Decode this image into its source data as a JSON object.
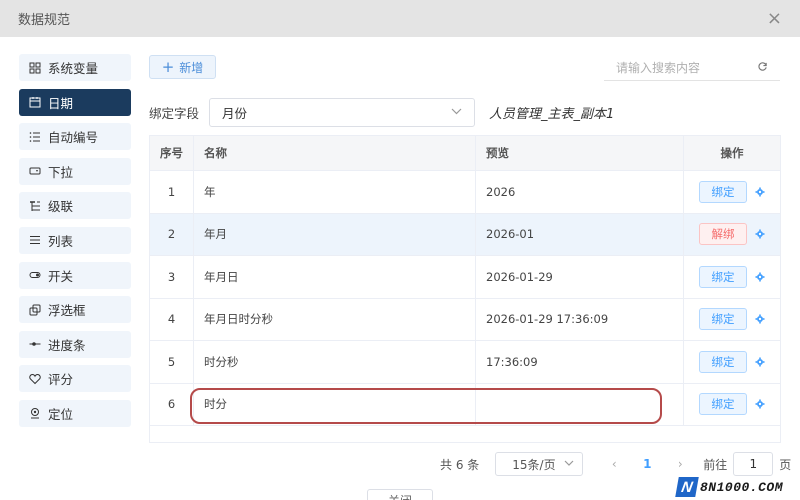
{
  "dialog": {
    "title": "数据规范",
    "close_glyph": "×"
  },
  "sidebar": {
    "items": [
      {
        "label": "系统变量",
        "icon": "grid-icon",
        "active": false
      },
      {
        "label": "日期",
        "icon": "calendar-icon",
        "active": true
      },
      {
        "label": "自动编号",
        "icon": "numbered-list-icon",
        "active": false
      },
      {
        "label": "下拉",
        "icon": "dropdown-icon",
        "active": false
      },
      {
        "label": "级联",
        "icon": "cascade-icon",
        "active": false
      },
      {
        "label": "列表",
        "icon": "list-icon",
        "active": false
      },
      {
        "label": "开关",
        "icon": "toggle-icon",
        "active": false
      },
      {
        "label": "浮选框",
        "icon": "popup-select-icon",
        "active": false
      },
      {
        "label": "进度条",
        "icon": "progress-icon",
        "active": false
      },
      {
        "label": "评分",
        "icon": "heart-icon",
        "active": false
      },
      {
        "label": "定位",
        "icon": "location-icon",
        "active": false
      }
    ]
  },
  "toolbar": {
    "add_plus": "+",
    "add_label": "新增",
    "search_placeholder": "请输入搜索内容",
    "search_value": ""
  },
  "bind": {
    "label": "绑定字段",
    "selected": "月份",
    "table_name": "人员管理_主表_副本1"
  },
  "table": {
    "headers": {
      "no": "序号",
      "name": "名称",
      "preview": "预览",
      "op": "操作"
    },
    "rows": [
      {
        "no": "1",
        "name": "年",
        "preview": "2026",
        "action": "绑定",
        "bound": false
      },
      {
        "no": "2",
        "name": "年月",
        "preview": "2026-01",
        "action": "解绑",
        "bound": true
      },
      {
        "no": "3",
        "name": "年月日",
        "preview": "2026-01-29",
        "action": "绑定",
        "bound": false
      },
      {
        "no": "4",
        "name": "年月日时分秒",
        "preview": "2026-01-29 17:36:09",
        "action": "绑定",
        "bound": false
      },
      {
        "no": "5",
        "name": "时分秒",
        "preview": "17:36:09",
        "action": "绑定",
        "bound": false
      },
      {
        "no": "6",
        "name": "时分",
        "preview": "",
        "action": "绑定",
        "bound": false
      }
    ]
  },
  "pager": {
    "total": "共 6 条",
    "page_size": "15条/页",
    "prev": "‹",
    "next": "›",
    "current": "1",
    "goto_label": "前往",
    "goto_value": "1",
    "goto_unit": "页"
  },
  "footer": {
    "close_label": "关闭"
  },
  "watermark": {
    "letter": "N",
    "text": "8N1000.COM"
  },
  "colors": {
    "accent": "#409eff",
    "sidebar_active": "#1b3b5e",
    "unbind": "#f56c6c",
    "highlight_box": "#b54a4a"
  }
}
